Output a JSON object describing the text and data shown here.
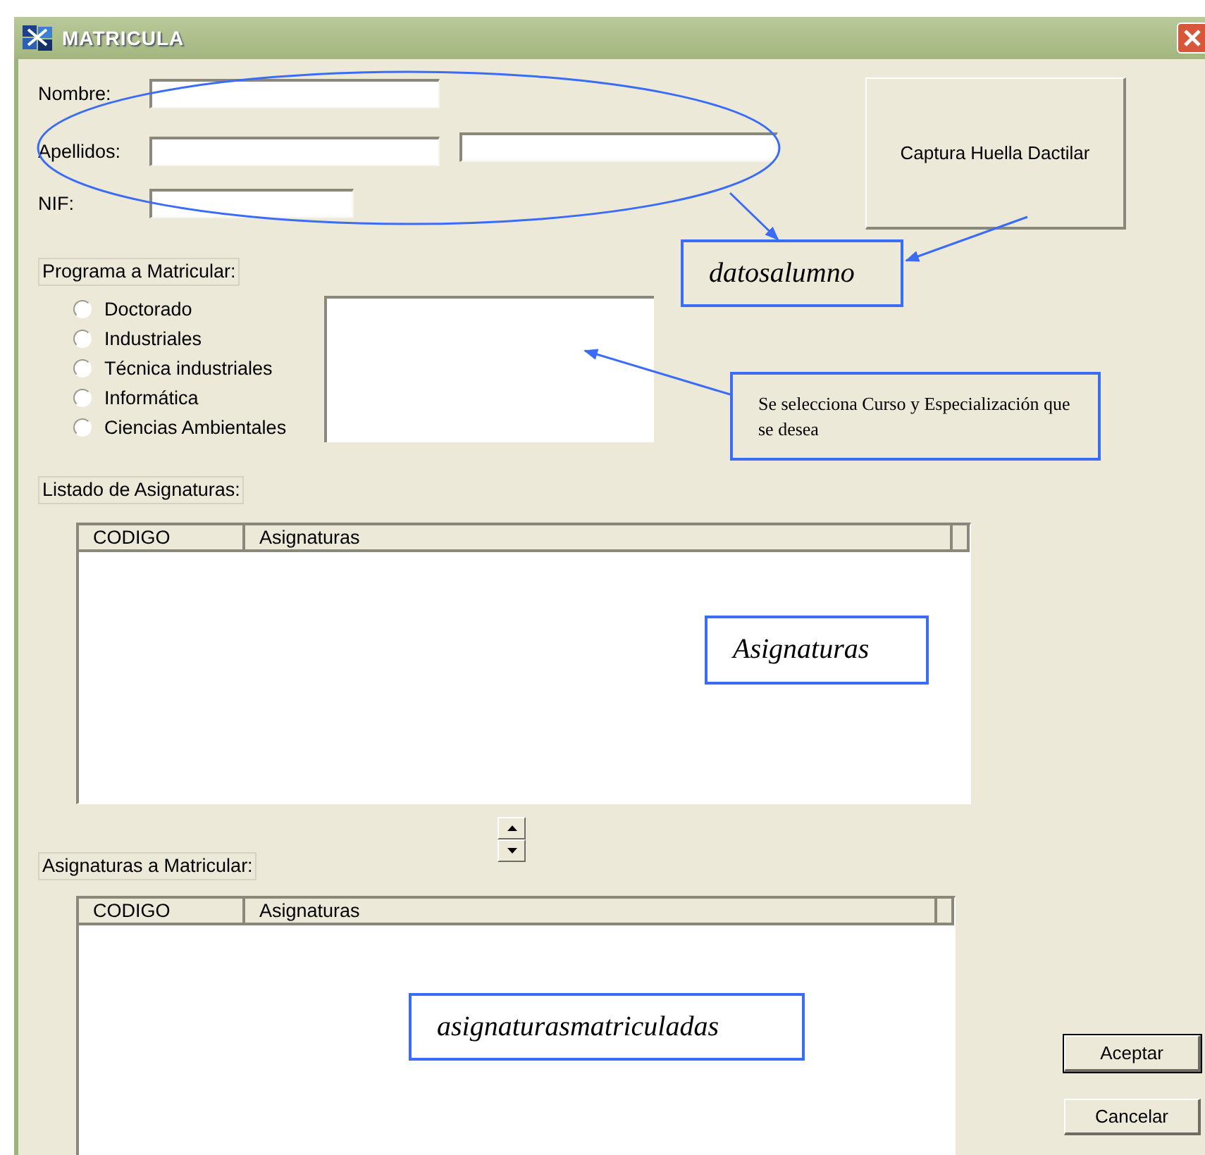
{
  "window": {
    "title": "MATRICULA"
  },
  "fields": [
    {
      "label": "Nombre:",
      "kind": "single"
    },
    {
      "label": "Apellidos:",
      "kind": "double"
    },
    {
      "label": "NIF:",
      "kind": "short"
    }
  ],
  "fingerprint_button": "Captura Huella Dactilar",
  "program_group": {
    "label": "Programa a Matricular:",
    "options": [
      {
        "label": "Doctorado",
        "selected": false
      },
      {
        "label": "Industriales",
        "selected": false
      },
      {
        "label": "Técnica industriales",
        "selected": false
      },
      {
        "label": "Informática",
        "selected": false
      },
      {
        "label": "Ciencias Ambientales",
        "selected": false
      }
    ]
  },
  "subjects_list": {
    "label": "Listado de Asignaturas:",
    "columns": [
      "CODIGO",
      "Asignaturas"
    ]
  },
  "enrolled_list": {
    "label": "Asignaturas a Matricular:",
    "columns": [
      "CODIGO",
      "Asignaturas"
    ]
  },
  "buttons": [
    {
      "label": "Aceptar",
      "kind": "default"
    },
    {
      "label": "Cancelar",
      "kind": "normal"
    }
  ],
  "annotations": [
    {
      "text": "datosalumno",
      "kind": "title"
    },
    {
      "text": "Se selecciona Curso y Especialización que se desea",
      "kind": "note"
    },
    {
      "text": "Asignaturas",
      "kind": "title"
    },
    {
      "text": "asignaturasmatriculadas",
      "kind": "title"
    }
  ]
}
